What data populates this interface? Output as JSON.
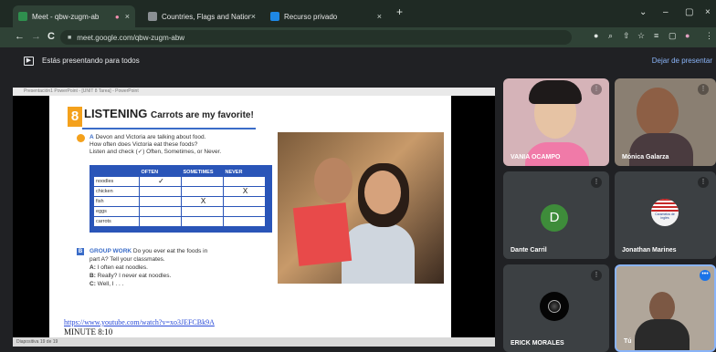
{
  "tabs": [
    {
      "label": "Meet - qbw-zugm-abw",
      "close": "×",
      "color": "#2f8f4e"
    },
    {
      "label": "Countries, Flags and Nationalitie",
      "close": "×",
      "color": "#8a8f93"
    },
    {
      "label": "Recurso privado",
      "close": "×",
      "color": "#1e88e5"
    }
  ],
  "new_tab": "+",
  "window_controls": {
    "minimize": "–",
    "maximize": "▢",
    "close": "×",
    "chevron": "⌄"
  },
  "nav": {
    "back": "←",
    "forward": "→",
    "reload": "C",
    "lock": "🔒"
  },
  "url": "meet.google.com/qbw-zugm-abw",
  "toolbar_icons": [
    "●",
    "🔍",
    "⇧",
    "☆",
    "≡",
    "▢",
    "●",
    "⋮"
  ],
  "banner": {
    "icon": "▶",
    "text": "Estás presentando para todos",
    "stop": "Dejar de presentar"
  },
  "slide": {
    "window_title": "Presentación1 PowerPoint - [UNIT 8 Tarea] - PowerPoint",
    "lesson_number": "8",
    "title_main": "LISTENING",
    "title_sub": "Carrots are my favorite!",
    "a_label": "A",
    "a_lines": [
      "Devon and Victoria are talking about food.",
      "How often does Victoria eat these foods?",
      "Listen and check (✓) Often, Sometimes, or Never."
    ],
    "grid": {
      "headers": [
        "",
        "OFTEN",
        "SOMETIMES",
        "NEVER"
      ],
      "rows": [
        [
          "noodles",
          "✓",
          "",
          ""
        ],
        [
          "chicken",
          "",
          "",
          "X"
        ],
        [
          "fish",
          "",
          "X",
          ""
        ],
        [
          "eggs",
          "",
          "",
          ""
        ],
        [
          "carrots",
          "",
          "",
          ""
        ]
      ]
    },
    "b_label": "B",
    "b_heading": "GROUP WORK",
    "b_lines": [
      "Do you ever eat the foods in",
      "part A? Tell your classmates."
    ],
    "dialog": [
      {
        "speaker": "A:",
        "text": "I often eat noodles."
      },
      {
        "speaker": "B:",
        "text": "Really? I never eat noodles."
      },
      {
        "speaker": "C:",
        "text": "Well, I . . ."
      }
    ],
    "link": "https://www.youtube.com/watch?v=xo3JEFCBk9A",
    "minute": "MINUTE 8:10",
    "status": "Diapositiva 19 de 19"
  },
  "participants": [
    {
      "name": "VANIA OCAMPO",
      "mic": "⋮",
      "type": "video",
      "bg": "#c9a0a6"
    },
    {
      "name": "Mónica Galarza",
      "mic": "⋮",
      "type": "video",
      "bg": "#8a7d70"
    },
    {
      "name": "Dante Carril",
      "mic": "⋮",
      "type": "avatar",
      "initial": "D"
    },
    {
      "name": "Jonathan Marines",
      "mic": "⋮",
      "type": "flag",
      "flag_text": "Caramelos de inglés"
    },
    {
      "name": "ERICK MORALES",
      "mic": "⋮",
      "type": "planet"
    },
    {
      "name": "Tú",
      "mic": "•••",
      "type": "video",
      "bg": "#a8a198"
    }
  ]
}
